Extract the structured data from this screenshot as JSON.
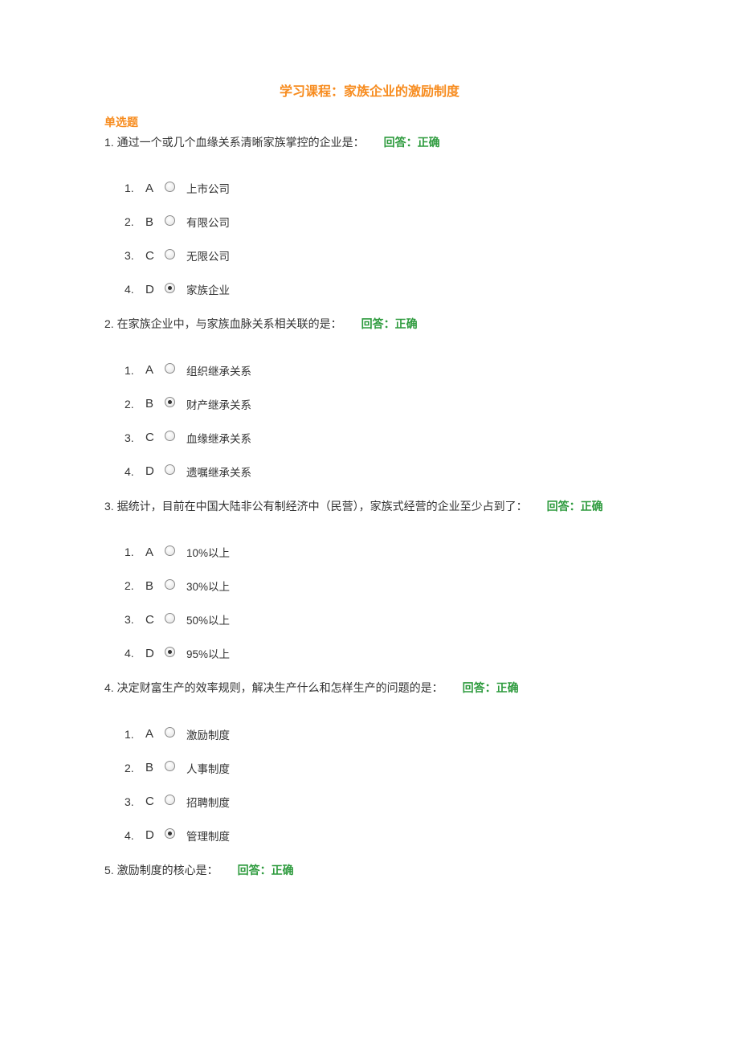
{
  "title": "学习课程：家族企业的激励制度",
  "section_heading": "单选题",
  "feedback_correct": "回答：正确",
  "questions": [
    {
      "num": "1.",
      "text": "通过一个或几个血缘关系清晰家族掌控的企业是：",
      "selected": 3,
      "options": [
        {
          "n": "1.",
          "letter": "A",
          "label": "上市公司"
        },
        {
          "n": "2.",
          "letter": "B",
          "label": "有限公司"
        },
        {
          "n": "3.",
          "letter": "C",
          "label": "无限公司"
        },
        {
          "n": "4.",
          "letter": "D",
          "label": "家族企业"
        }
      ]
    },
    {
      "num": "2.",
      "text": "在家族企业中，与家族血脉关系相关联的是：",
      "selected": 1,
      "options": [
        {
          "n": "1.",
          "letter": "A",
          "label": "组织继承关系"
        },
        {
          "n": "2.",
          "letter": "B",
          "label": "财产继承关系"
        },
        {
          "n": "3.",
          "letter": "C",
          "label": "血缘继承关系"
        },
        {
          "n": "4.",
          "letter": "D",
          "label": "遗嘱继承关系"
        }
      ]
    },
    {
      "num": "3.",
      "text": "据统计，目前在中国大陆非公有制经济中（民营），家族式经营的企业至少占到了：",
      "selected": 3,
      "options": [
        {
          "n": "1.",
          "letter": "A",
          "label": "10%以上"
        },
        {
          "n": "2.",
          "letter": "B",
          "label": "30%以上"
        },
        {
          "n": "3.",
          "letter": "C",
          "label": "50%以上"
        },
        {
          "n": "4.",
          "letter": "D",
          "label": "95%以上"
        }
      ]
    },
    {
      "num": "4.",
      "text": "决定财富生产的效率规则，解决生产什么和怎样生产的问题的是：",
      "selected": 3,
      "options": [
        {
          "n": "1.",
          "letter": "A",
          "label": "激励制度"
        },
        {
          "n": "2.",
          "letter": "B",
          "label": "人事制度"
        },
        {
          "n": "3.",
          "letter": "C",
          "label": "招聘制度"
        },
        {
          "n": "4.",
          "letter": "D",
          "label": "管理制度"
        }
      ]
    },
    {
      "num": "5.",
      "text": "激励制度的核心是：",
      "selected": -1,
      "options": []
    }
  ]
}
